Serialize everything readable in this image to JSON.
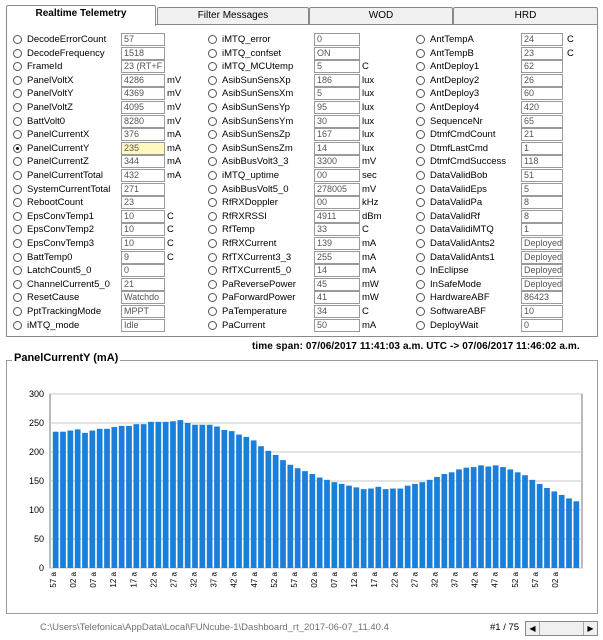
{
  "tabs": [
    "Realtime Telemetry",
    "Filter Messages",
    "WOD",
    "HRD"
  ],
  "col1": [
    {
      "label": "DecodeErrorCount",
      "value": "57",
      "unit": ""
    },
    {
      "label": "DecodeFrequency",
      "value": "1518",
      "unit": ""
    },
    {
      "label": "FrameId",
      "value": "23 (RT+F",
      "unit": ""
    },
    {
      "label": "PanelVoltX",
      "value": "4286",
      "unit": "mV"
    },
    {
      "label": "PanelVoltY",
      "value": "4369",
      "unit": "mV"
    },
    {
      "label": "PanelVoltZ",
      "value": "4095",
      "unit": "mV"
    },
    {
      "label": "BattVolt0",
      "value": "8280",
      "unit": "mV"
    },
    {
      "label": "PanelCurrentX",
      "value": "376",
      "unit": "mA"
    },
    {
      "label": "PanelCurrentY",
      "value": "235",
      "unit": "mA",
      "selected": true
    },
    {
      "label": "PanelCurrentZ",
      "value": "344",
      "unit": "mA"
    },
    {
      "label": "PanelCurrentTotal",
      "value": "432",
      "unit": "mA"
    },
    {
      "label": "SystemCurrentTotal",
      "value": "271",
      "unit": ""
    },
    {
      "label": "RebootCount",
      "value": "23",
      "unit": ""
    },
    {
      "label": "EpsConvTemp1",
      "value": "10",
      "unit": "C"
    },
    {
      "label": "EpsConvTemp2",
      "value": "10",
      "unit": "C"
    },
    {
      "label": "EpsConvTemp3",
      "value": "10",
      "unit": "C"
    },
    {
      "label": "BattTemp0",
      "value": "9",
      "unit": "C"
    },
    {
      "label": "LatchCount5_0",
      "value": "0",
      "unit": ""
    },
    {
      "label": "ChannelCurrent5_0",
      "value": "21",
      "unit": ""
    },
    {
      "label": "ResetCause",
      "value": "Watchdo",
      "unit": ""
    },
    {
      "label": "PptTrackingMode",
      "value": "MPPT",
      "unit": ""
    },
    {
      "label": "iMTQ_mode",
      "value": "Idle",
      "unit": ""
    }
  ],
  "col2": [
    {
      "label": "iMTQ_error",
      "value": "0",
      "unit": ""
    },
    {
      "label": "iMTQ_confset",
      "value": "ON",
      "unit": ""
    },
    {
      "label": "iMTQ_MCUtemp",
      "value": "5",
      "unit": "C"
    },
    {
      "label": "AsibSunSensXp",
      "value": "186",
      "unit": "lux"
    },
    {
      "label": "AsibSunSensXm",
      "value": "5",
      "unit": "lux"
    },
    {
      "label": "AsibSunSensYp",
      "value": "95",
      "unit": "lux"
    },
    {
      "label": "AsibSunSensYm",
      "value": "30",
      "unit": "lux"
    },
    {
      "label": "AsibSunSensZp",
      "value": "167",
      "unit": "lux"
    },
    {
      "label": "AsibSunSensZm",
      "value": "14",
      "unit": "lux"
    },
    {
      "label": "AsibBusVolt3_3",
      "value": "3300",
      "unit": "mV"
    },
    {
      "label": "iMTQ_uptime",
      "value": "00",
      "unit": "sec"
    },
    {
      "label": "AsibBusVolt5_0",
      "value": "278005",
      "unit": "mV"
    },
    {
      "label": "RfRXDoppler",
      "value": "00",
      "unit": "kHz"
    },
    {
      "label": "RfRXRSSI",
      "value": "4911",
      "unit": "dBm"
    },
    {
      "label": "RfTemp",
      "value": "33",
      "unit": "C"
    },
    {
      "label": "RfRXCurrent",
      "value": "139",
      "unit": "mA"
    },
    {
      "label": "RfTXCurrent3_3",
      "value": "255",
      "unit": "mA"
    },
    {
      "label": "RfTXCurrent5_0",
      "value": "14",
      "unit": "mA"
    },
    {
      "label": "PaReversePower",
      "value": "45",
      "unit": "mW"
    },
    {
      "label": "PaForwardPower",
      "value": "41",
      "unit": "mW"
    },
    {
      "label": "PaTemperature",
      "value": "34",
      "unit": "C"
    },
    {
      "label": "PaCurrent",
      "value": "50",
      "unit": "mA"
    }
  ],
  "col3": [
    {
      "label": "AntTempA",
      "value": "24",
      "unit": "C"
    },
    {
      "label": "AntTempB",
      "value": "23",
      "unit": "C"
    },
    {
      "label": "AntDeploy1",
      "value": "62",
      "unit": ""
    },
    {
      "label": "AntDeploy2",
      "value": "26",
      "unit": ""
    },
    {
      "label": "AntDeploy3",
      "value": "60",
      "unit": ""
    },
    {
      "label": "AntDeploy4",
      "value": "420",
      "unit": ""
    },
    {
      "label": "SequenceNr",
      "value": "65",
      "unit": ""
    },
    {
      "label": "DtmfCmdCount",
      "value": "21",
      "unit": ""
    },
    {
      "label": "DtmfLastCmd",
      "value": "1",
      "unit": ""
    },
    {
      "label": "DtmfCmdSuccess",
      "value": "118",
      "unit": ""
    },
    {
      "label": "DataValidBob",
      "value": "51",
      "unit": ""
    },
    {
      "label": "DataValidEps",
      "value": "5",
      "unit": ""
    },
    {
      "label": "DataValidPa",
      "value": "8",
      "unit": ""
    },
    {
      "label": "DataValidRf",
      "value": "8",
      "unit": ""
    },
    {
      "label": "DataValidiMTQ",
      "value": "1",
      "unit": ""
    },
    {
      "label": "DataValidAnts2",
      "value": "Deployed",
      "unit": ""
    },
    {
      "label": "DataValidAnts1",
      "value": "Deployed",
      "unit": ""
    },
    {
      "label": "InEclipse",
      "value": "Deployed",
      "unit": ""
    },
    {
      "label": "InSafeMode",
      "value": "Deployed",
      "unit": ""
    },
    {
      "label": "HardwareABF",
      "value": "86423",
      "unit": ""
    },
    {
      "label": "SoftwareABF",
      "value": "10",
      "unit": ""
    },
    {
      "label": "DeployWait",
      "value": "0",
      "unit": ""
    }
  ],
  "timespan": "time span: 07/06/2017 11:41:03 a.m. UTC -> 07/06/2017 11:46:02 a.m.",
  "chart_data": {
    "type": "bar",
    "title": "PanelCurrentY (mA)",
    "bar_color": "#1a7fd8",
    "ylim": [
      0,
      300
    ],
    "yticks": [
      0,
      50,
      100,
      150,
      200,
      250,
      300
    ],
    "grid": true,
    "x_tick_labels": [
      "57 a",
      "02 a",
      "07 a",
      "12 a",
      "17 a",
      "22 a",
      "27 a",
      "32 a",
      "37 a",
      "42 a",
      "47 a",
      "52 a",
      "57 a",
      "02 a",
      "07 a",
      "12 a",
      "17 a",
      "22 a",
      "27 a",
      "32 a",
      "37 a",
      "42 a",
      "47 a",
      "52 a",
      "57 a",
      "02 a"
    ],
    "values": [
      235,
      235,
      237,
      239,
      233,
      237,
      240,
      240,
      243,
      245,
      245,
      248,
      248,
      252,
      252,
      252,
      253,
      255,
      250,
      247,
      247,
      247,
      244,
      238,
      236,
      230,
      226,
      220,
      210,
      202,
      195,
      186,
      178,
      172,
      167,
      162,
      156,
      152,
      148,
      145,
      142,
      139,
      136,
      137,
      140,
      136,
      137,
      137,
      142,
      145,
      148,
      152,
      157,
      162,
      165,
      170,
      173,
      174,
      177,
      175,
      177,
      174,
      170,
      165,
      160,
      152,
      145,
      138,
      132,
      126,
      120,
      115
    ]
  },
  "status": {
    "path": "C:\\Users\\Telefonica\\AppData\\Local\\FUNcube-1\\Dashboard_rt_2017-06-07_11.40.4",
    "page": "#1 / 75"
  }
}
